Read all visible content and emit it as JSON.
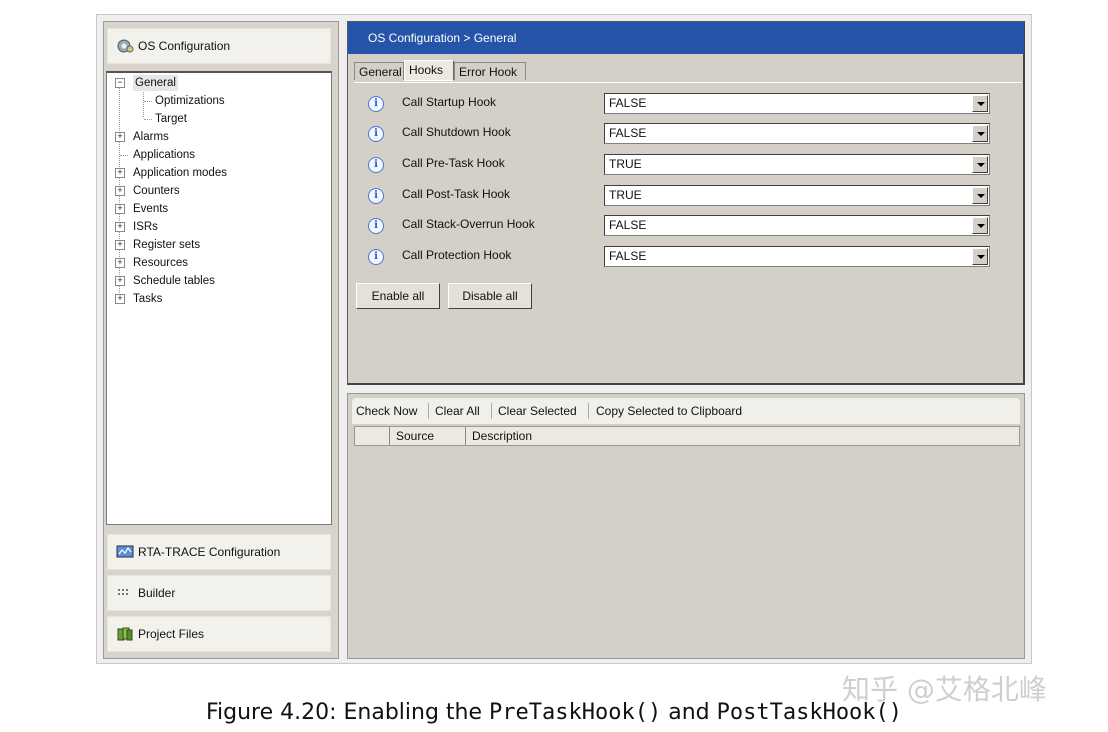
{
  "nav": {
    "os_config_label": "OS Configuration",
    "rta_trace_label": "RTA-TRACE Configuration",
    "builder_label": "Builder",
    "project_files_label": "Project Files"
  },
  "tree": {
    "items": [
      {
        "label": "General",
        "expander": "−"
      },
      {
        "label": "Optimizations"
      },
      {
        "label": "Target"
      },
      {
        "label": "Alarms",
        "expander": "+"
      },
      {
        "label": "Applications"
      },
      {
        "label": "Application modes",
        "expander": "+"
      },
      {
        "label": "Counters",
        "expander": "+"
      },
      {
        "label": "Events",
        "expander": "+"
      },
      {
        "label": "ISRs",
        "expander": "+"
      },
      {
        "label": "Register sets",
        "expander": "+"
      },
      {
        "label": "Resources",
        "expander": "+"
      },
      {
        "label": "Schedule tables",
        "expander": "+"
      },
      {
        "label": "Tasks",
        "expander": "+"
      }
    ]
  },
  "header": {
    "breadcrumb": "OS Configuration  >  General"
  },
  "tabs": [
    {
      "label": "General"
    },
    {
      "label": "Hooks"
    },
    {
      "label": "Error Hook"
    }
  ],
  "hooks": [
    {
      "label": "Call Startup Hook",
      "value": "FALSE"
    },
    {
      "label": "Call Shutdown Hook",
      "value": "FALSE"
    },
    {
      "label": "Call Pre-Task Hook",
      "value": "TRUE"
    },
    {
      "label": "Call Post-Task Hook",
      "value": "TRUE"
    },
    {
      "label": "Call Stack-Overrun Hook",
      "value": "FALSE"
    },
    {
      "label": "Call Protection Hook",
      "value": "FALSE"
    }
  ],
  "buttons": {
    "enable_all": "Enable all",
    "disable_all": "Disable all"
  },
  "toolbar": {
    "check_now": "Check Now",
    "clear_all": "Clear All",
    "clear_selected": "Clear Selected",
    "copy_selected": "Copy Selected to Clipboard"
  },
  "grid": {
    "source": "Source",
    "description": "Description"
  },
  "watermark": "知乎 @艾格北峰",
  "caption": {
    "prefix": "Figure 4.20: Enabling the ",
    "pre": "PreTaskHook()",
    "and": " and ",
    "post": "PostTaskHook()"
  }
}
